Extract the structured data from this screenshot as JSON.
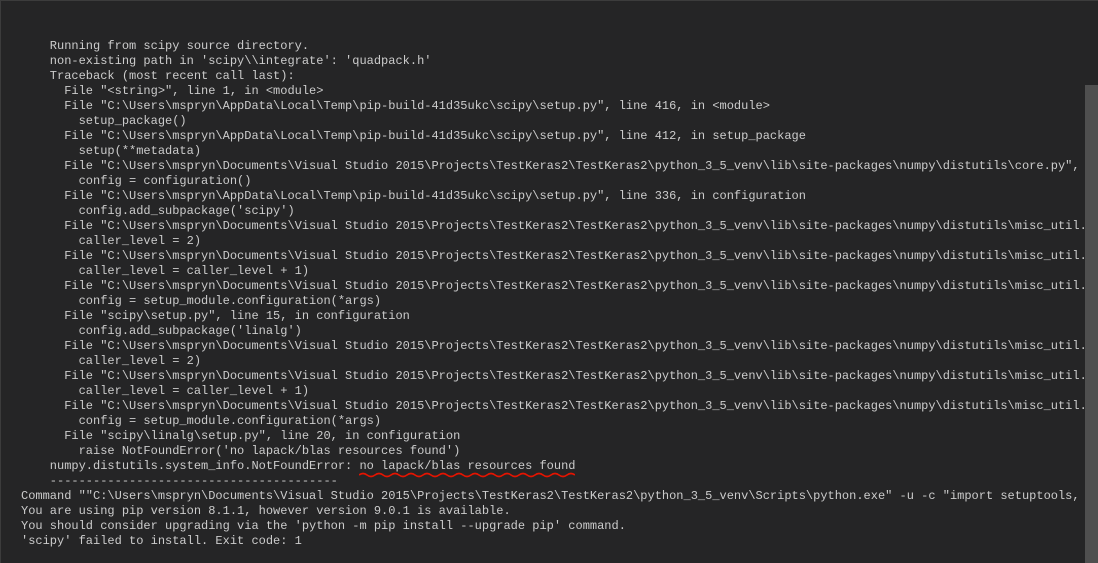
{
  "terminal": {
    "lines": [
      "    Running from scipy source directory.",
      "    non-existing path in 'scipy\\\\integrate': 'quadpack.h'",
      "    Traceback (most recent call last):",
      "      File \"<string>\", line 1, in <module>",
      "      File \"C:\\Users\\mspryn\\AppData\\Local\\Temp\\pip-build-41d35ukc\\scipy\\setup.py\", line 416, in <module>",
      "        setup_package()",
      "      File \"C:\\Users\\mspryn\\AppData\\Local\\Temp\\pip-build-41d35ukc\\scipy\\setup.py\", line 412, in setup_package",
      "        setup(**metadata)",
      "      File \"C:\\Users\\mspryn\\Documents\\Visual Studio 2015\\Projects\\TestKeras2\\TestKeras2\\python_3_5_venv\\lib\\site-packages\\numpy\\distutils\\core.py\", line",
      "        config = configuration()",
      "      File \"C:\\Users\\mspryn\\AppData\\Local\\Temp\\pip-build-41d35ukc\\scipy\\setup.py\", line 336, in configuration",
      "        config.add_subpackage('scipy')",
      "      File \"C:\\Users\\mspryn\\Documents\\Visual Studio 2015\\Projects\\TestKeras2\\TestKeras2\\python_3_5_venv\\lib\\site-packages\\numpy\\distutils\\misc_util.py\",",
      "        caller_level = 2)",
      "      File \"C:\\Users\\mspryn\\Documents\\Visual Studio 2015\\Projects\\TestKeras2\\TestKeras2\\python_3_5_venv\\lib\\site-packages\\numpy\\distutils\\misc_util.py\",",
      "        caller_level = caller_level + 1)",
      "      File \"C:\\Users\\mspryn\\Documents\\Visual Studio 2015\\Projects\\TestKeras2\\TestKeras2\\python_3_5_venv\\lib\\site-packages\\numpy\\distutils\\misc_util.py\",",
      "        config = setup_module.configuration(*args)",
      "      File \"scipy\\setup.py\", line 15, in configuration",
      "        config.add_subpackage('linalg')",
      "      File \"C:\\Users\\mspryn\\Documents\\Visual Studio 2015\\Projects\\TestKeras2\\TestKeras2\\python_3_5_venv\\lib\\site-packages\\numpy\\distutils\\misc_util.py\",",
      "        caller_level = 2)",
      "      File \"C:\\Users\\mspryn\\Documents\\Visual Studio 2015\\Projects\\TestKeras2\\TestKeras2\\python_3_5_venv\\lib\\site-packages\\numpy\\distutils\\misc_util.py\",",
      "        caller_level = caller_level + 1)",
      "      File \"C:\\Users\\mspryn\\Documents\\Visual Studio 2015\\Projects\\TestKeras2\\TestKeras2\\python_3_5_venv\\lib\\site-packages\\numpy\\distutils\\misc_util.py\",",
      "        config = setup_module.configuration(*args)",
      "      File \"scipy\\linalg\\setup.py\", line 20, in configuration",
      "        raise NotFoundError('no lapack/blas resources found')",
      "    numpy.distutils.system_info.NotFoundError: no lapack/blas resources found",
      "",
      "    ----------------------------------------",
      "Command \"\"C:\\Users\\mspryn\\Documents\\Visual Studio 2015\\Projects\\TestKeras2\\TestKeras2\\python_3_5_venv\\Scripts\\python.exe\" -u -c \"import setuptools, toke",
      "You are using pip version 8.1.1, however version 9.0.1 is available.",
      "You should consider upgrading via the 'python -m pip install --upgrade pip' command.",
      "'scipy' failed to install. Exit code: 1"
    ]
  },
  "highlight": {
    "line_index": 28,
    "text": "no lapack/blas resources found",
    "color": "#e51400"
  },
  "scrollbar": {
    "thumb_top_pct": 15,
    "thumb_height_pct": 85
  }
}
